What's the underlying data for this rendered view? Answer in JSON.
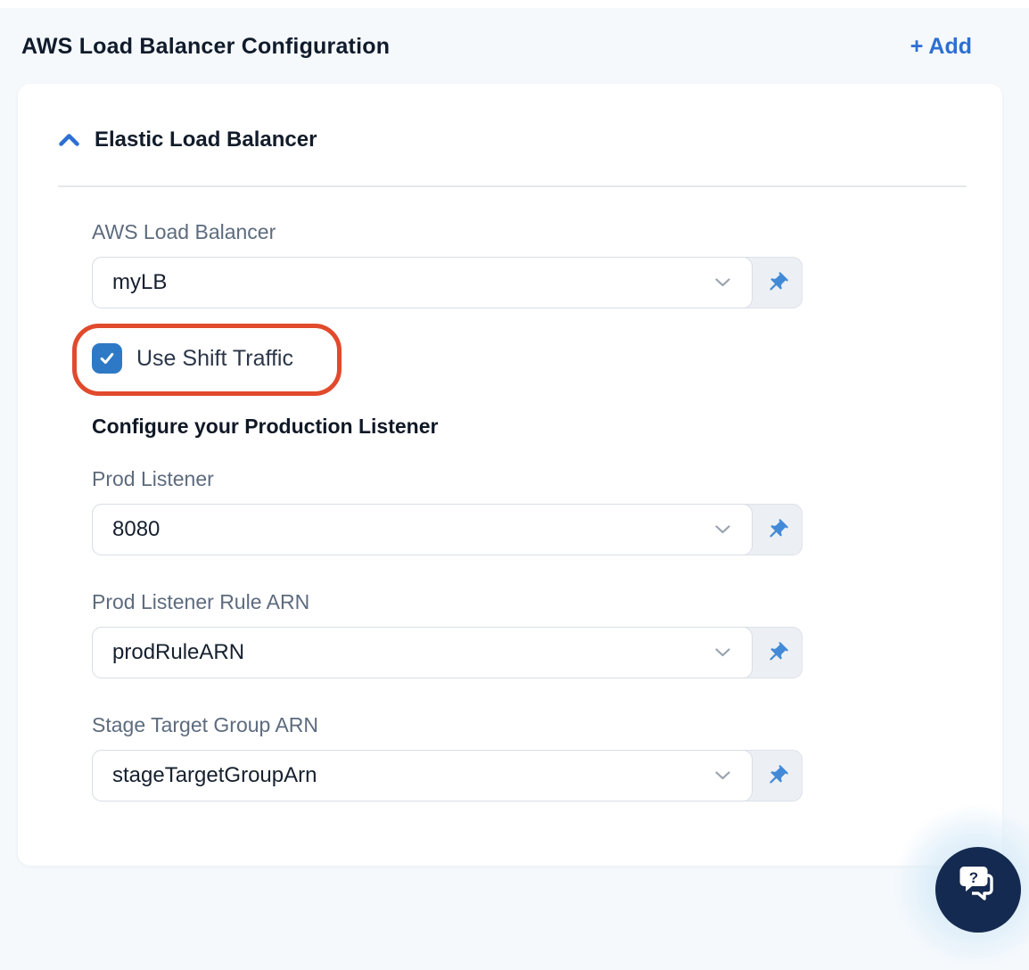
{
  "colors": {
    "accent_blue": "#2d6fd3",
    "checkbox_blue": "#2e79c5",
    "annotation_red": "#e14a2c",
    "help_navy": "#152a50",
    "page_background": "#f5f9fc"
  },
  "header": {
    "title": "AWS Load Balancer Configuration",
    "add_label": "+ Add"
  },
  "card": {
    "section": {
      "title": "Elastic Load Balancer",
      "collapse_icon": "chevron-up-icon",
      "state": "expanded"
    },
    "checkbox": {
      "label": "Use Shift Traffic",
      "checked": true
    },
    "subheading": "Configure your Production Listener",
    "fields": [
      {
        "label": "AWS Load Balancer",
        "value": "myLB"
      },
      {
        "label": "Prod Listener",
        "value": "8080"
      },
      {
        "label": "Prod Listener Rule ARN",
        "value": "prodRuleARN"
      },
      {
        "label": "Stage Target Group ARN",
        "value": "stageTargetGroupArn"
      }
    ],
    "field_icons": [
      "chevron-down-icon",
      "pushpin-icon"
    ]
  },
  "annotation": {
    "shape": "rounded-rect-outline",
    "color": "#e14a2c"
  },
  "help": {
    "icon": "chat-question-icon",
    "glyph": "?"
  }
}
